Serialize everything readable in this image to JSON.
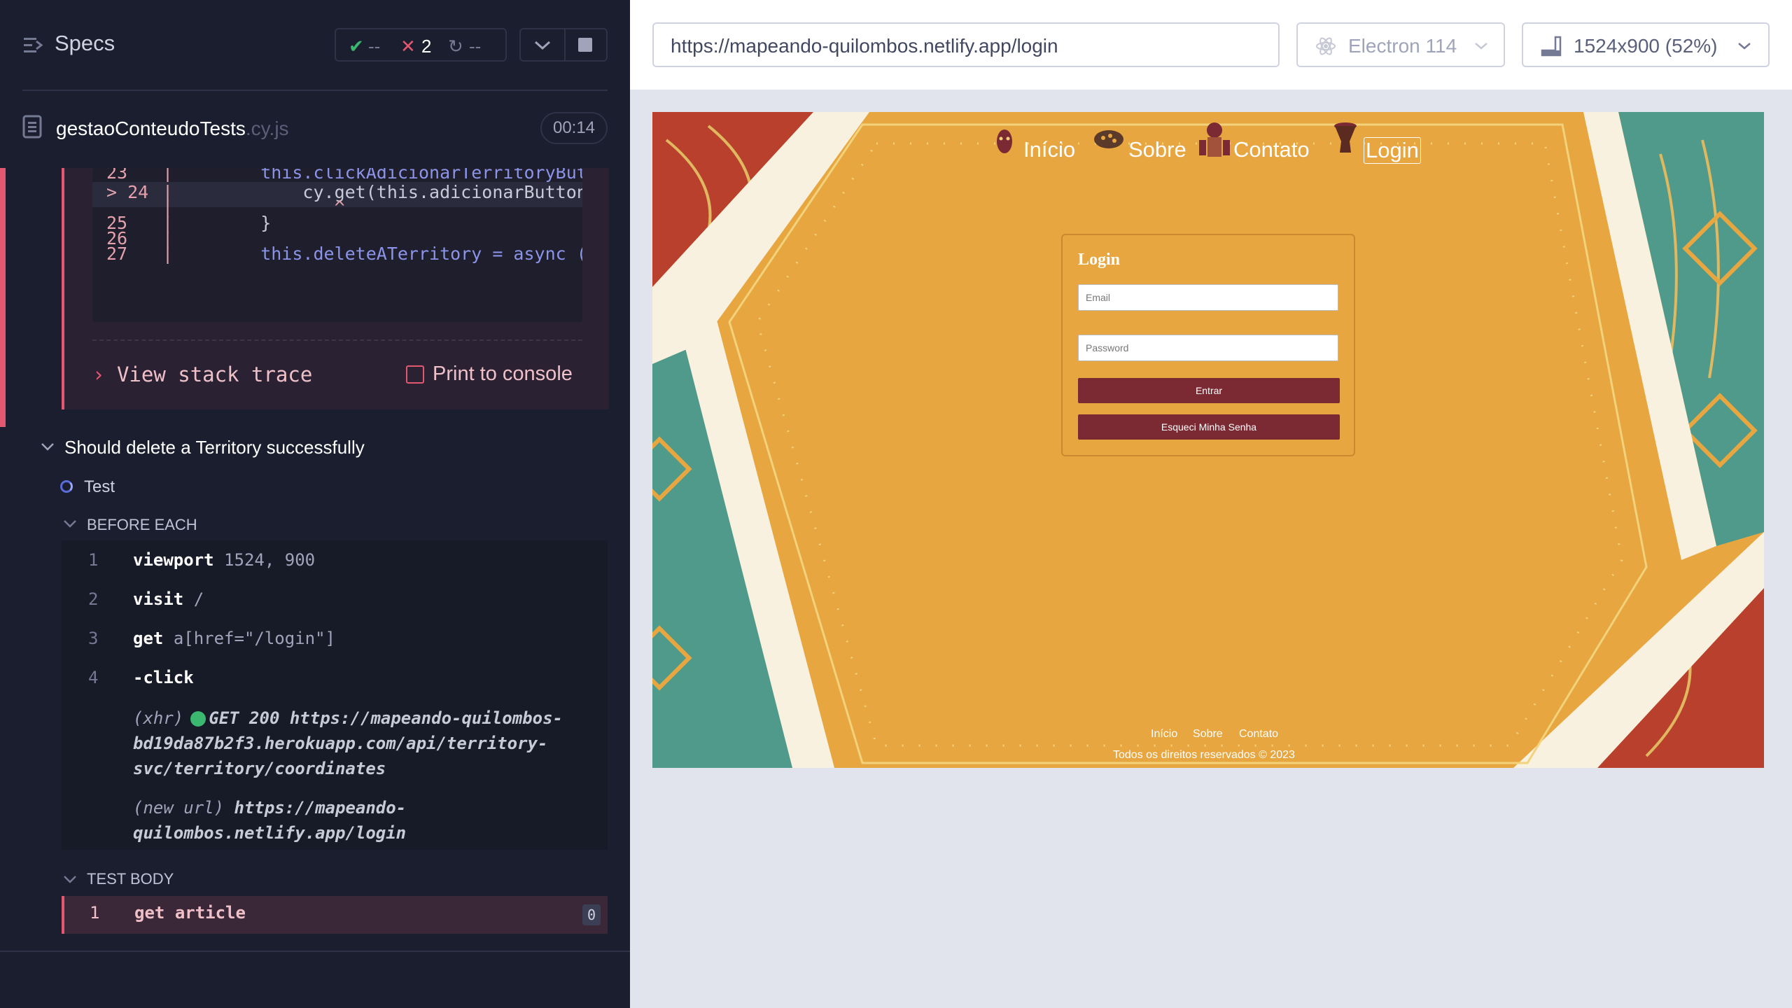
{
  "reporter": {
    "specs_label": "Specs",
    "stats": {
      "passed": "--",
      "failed": "2",
      "pending": "--"
    },
    "file": {
      "name": "gestaoConteudoTests",
      "ext": ".cy.js"
    },
    "duration": "00:14",
    "code_frame": [
      {
        "ln": "23",
        "bar": "|",
        "code": "    this.clickAdicionarTerritoryButto"
      },
      {
        "ln": "> 24",
        "bar": "|",
        "code": "        cy.get(this.adicionarButton)."
      },
      {
        "ln": "",
        "bar": "|",
        "code": "           ^"
      },
      {
        "ln": "25",
        "bar": "|",
        "code": "    }"
      },
      {
        "ln": "26",
        "bar": "|",
        "code": ""
      },
      {
        "ln": "27",
        "bar": "|",
        "code": "    this.deleteATerritory = async () ="
      }
    ],
    "view_stack_trace": "View stack trace",
    "print_to_console": "Print to console",
    "test_title": "Should delete a Territory successfully",
    "test_label": "Test",
    "before_each_label": "BEFORE EACH",
    "before_each": [
      {
        "n": "1",
        "name": "viewport",
        "arg": "1524, 900"
      },
      {
        "n": "2",
        "name": "visit",
        "arg": "/"
      },
      {
        "n": "3",
        "name": "get",
        "arg": "a[href=\"/login\"]"
      },
      {
        "n": "4",
        "name": "-click",
        "arg": ""
      }
    ],
    "xhr_log": {
      "tag": "(xhr)",
      "text": "GET 200 https://mapeando-quilombos-bd19da87b2f3.herokuapp.com/api/territory-svc/territory/coordinates"
    },
    "new_url_log": {
      "tag": "(new url)",
      "text": "https://mapeando-quilombos.netlify.app/login"
    },
    "test_body_label": "TEST BODY",
    "test_body": [
      {
        "n": "1",
        "name": "get",
        "arg": "article",
        "count": "0"
      }
    ]
  },
  "browser_bar": {
    "url": "https://mapeando-quilombos.netlify.app/login",
    "browser": "Electron 114",
    "viewport": "1524x900",
    "scale": "(52%)"
  },
  "site": {
    "nav": [
      "Início",
      "Sobre",
      "Contato",
      "Login"
    ],
    "login_title": "Login",
    "email_placeholder": "Email",
    "password_placeholder": "Password",
    "submit": "Entrar",
    "forgot": "Esqueci Minha Senha",
    "footer_links": [
      "Início",
      "Sobre",
      "Contato"
    ],
    "copyright": "Todos os direitos reservados © 2023"
  },
  "colors": {
    "failure": "#e45770",
    "brand_button": "#7b2933",
    "site_bg": "#e8a640",
    "success_dot": "#3bb770"
  }
}
